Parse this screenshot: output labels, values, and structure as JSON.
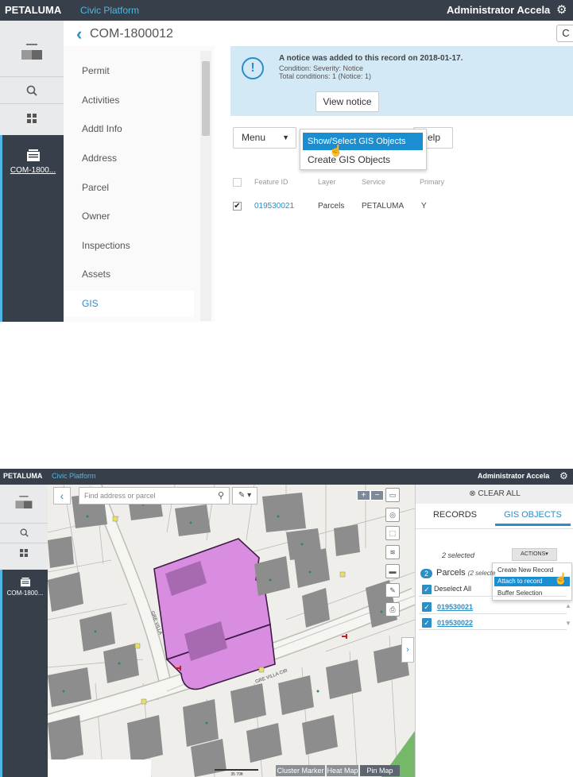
{
  "app": {
    "brand": "PETALUMA",
    "platform": "Civic Platform",
    "user": "Administrator Accela",
    "gear_glyph": "⚙"
  },
  "rail": {
    "record_label": "COM-1800..."
  },
  "panel1": {
    "record_id": "COM-1800012",
    "back_glyph": "‹",
    "refresh_glyph": "C",
    "tabs": [
      "Permit",
      "Activities",
      "Addtl Info",
      "Address",
      "Parcel",
      "Owner",
      "Inspections",
      "Assets",
      "GIS"
    ],
    "notice": {
      "line1": "A notice was added to this record on 2018-01-17.",
      "line2": "Condition: Severity: Notice",
      "line3": "Total conditions: 1 (Notice: 1)",
      "button": "View notice"
    },
    "menu_button": "Menu",
    "help_button": "elp",
    "dropdown": [
      "Show/Select GIS Objects",
      "Create GIS Objects"
    ],
    "table": {
      "headers": [
        "Feature ID",
        "Layer",
        "Service",
        "Primary"
      ],
      "row": {
        "feature_id": "019530021",
        "layer": "Parcels",
        "service": "PETALUMA",
        "primary": "Y"
      }
    }
  },
  "panel2": {
    "search_placeholder": "Find address or parcel",
    "clear_all": "CLEAR ALL",
    "tabs": [
      "RECORDS",
      "GIS OBJECTS"
    ],
    "selected_text": "2 selected",
    "actions_label": "ACTIONS",
    "actions_menu": [
      "Create New Record",
      "Attach to record",
      "Buffer Selection"
    ],
    "badge": "2",
    "group_title": "Parcels",
    "group_note": "(2 selecte",
    "deselect_all": "Deselect All",
    "parcels": [
      "019530021",
      "019530022"
    ],
    "street_labels": [
      "GRE VILLA",
      "GRE VILLA CIR"
    ],
    "map_toggles": [
      "Cluster Marker",
      "Heat Map",
      "Pin Map"
    ],
    "scale_label": "35 70ft"
  },
  "colors": {
    "topbar": "#37404a",
    "accent": "#2a8fc7",
    "selection": "#1a8ed1",
    "parcel_fill": "#d98de0",
    "parcel_stroke": "#3d1d45"
  }
}
